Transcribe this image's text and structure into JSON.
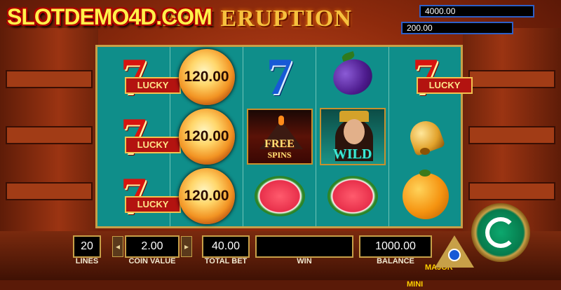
{
  "brand": {
    "watermark": "SLOTDEMO4D.COM",
    "game_title": "ASH ERUPTION"
  },
  "jackpots": [
    {
      "amount": "4000.00",
      "label": "MAJOR"
    },
    {
      "amount": "200.00",
      "label": "MINI"
    }
  ],
  "reels": {
    "columns": [
      [
        "lucky-seven",
        "lucky-seven",
        "lucky-seven"
      ],
      [
        "fireball",
        "fireball",
        "fireball"
      ],
      [
        "blue-seven",
        "free-spins-volcano",
        "watermelon"
      ],
      [
        "plum",
        "wild-queen",
        "watermelon"
      ],
      [
        "lucky-seven",
        "bell",
        "orange"
      ]
    ],
    "lucky_label": "LUCKY",
    "fireball_value": "120.00",
    "free_spins_line1": "FREE",
    "free_spins_line2": "SPINS",
    "wild_label": "WILD",
    "seven_glyph": "7"
  },
  "bottom_bar": {
    "lines_value": "20",
    "lines_label": "LINES",
    "coin_value": "2.00",
    "coin_value_label": "COIN VALUE",
    "total_bet_value": "40.00",
    "total_bet_label": "TOTAL BET",
    "win_value": "",
    "win_label": "WIN",
    "balance_value": "1000.00",
    "balance_label": "BALANCE"
  },
  "colors": {
    "reel_background": "#0f8e8a",
    "frame_gold": "#c7a048",
    "spin_green": "#067a4c"
  }
}
